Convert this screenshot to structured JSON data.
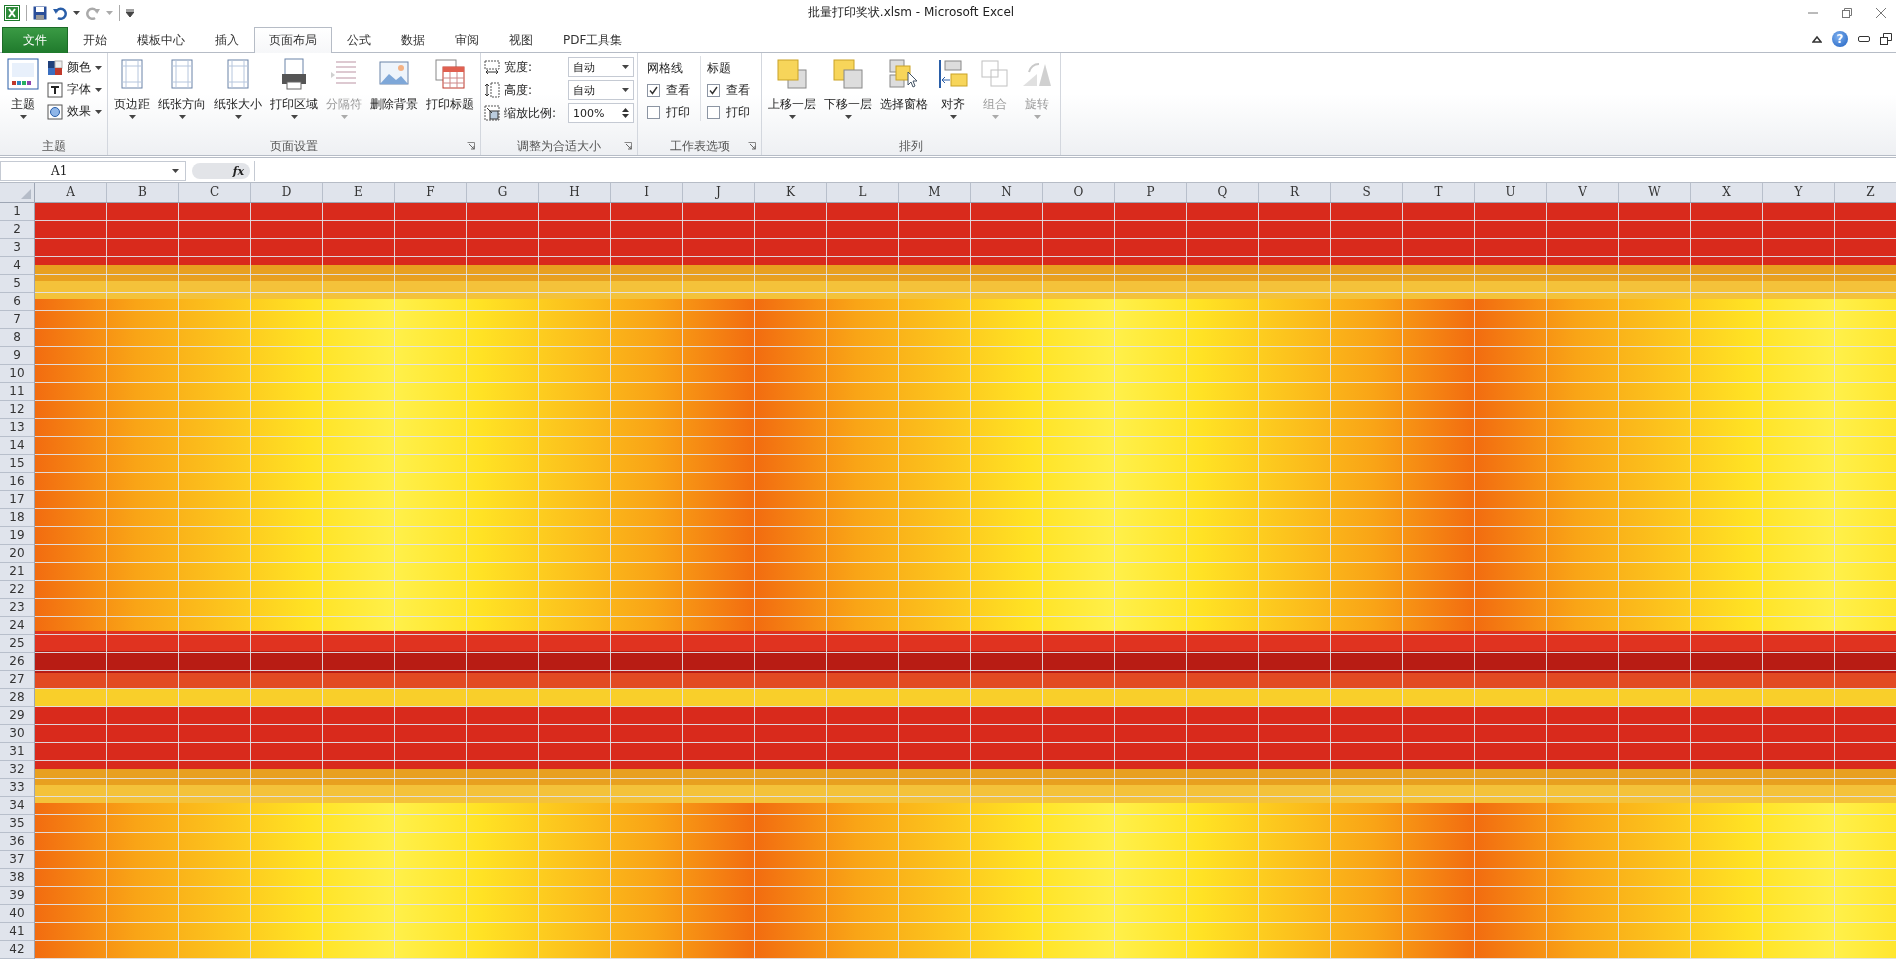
{
  "window": {
    "title": "批量打印奖状.xlsm  -  Microsoft Excel"
  },
  "tabs": [
    {
      "label": "文件",
      "kind": "file",
      "selected": false
    },
    {
      "label": "开始",
      "kind": "tab",
      "selected": false
    },
    {
      "label": "模板中心",
      "kind": "tab",
      "selected": false
    },
    {
      "label": "插入",
      "kind": "tab",
      "selected": false
    },
    {
      "label": "页面布局",
      "kind": "tab",
      "selected": true
    },
    {
      "label": "公式",
      "kind": "tab",
      "selected": false
    },
    {
      "label": "数据",
      "kind": "tab",
      "selected": false
    },
    {
      "label": "审阅",
      "kind": "tab",
      "selected": false
    },
    {
      "label": "视图",
      "kind": "tab",
      "selected": false
    },
    {
      "label": "PDF工具集",
      "kind": "tab",
      "selected": false
    }
  ],
  "help_button": {
    "label": "?"
  },
  "ribbon": {
    "groups": [
      {
        "title": "主题",
        "launcher": false,
        "items": [
          {
            "kind": "large",
            "label": "主题",
            "dropdown": true,
            "disabled": false
          },
          {
            "kind": "stack",
            "items": [
              {
                "label": "颜色",
                "dropdown": true
              },
              {
                "label": "字体",
                "dropdown": true
              },
              {
                "label": "效果",
                "dropdown": true
              }
            ]
          }
        ]
      },
      {
        "title": "页面设置",
        "launcher": true,
        "items": [
          {
            "kind": "large",
            "label": "页边距",
            "dropdown": true,
            "disabled": false
          },
          {
            "kind": "large",
            "label": "纸张方向",
            "dropdown": true,
            "disabled": false
          },
          {
            "kind": "large",
            "label": "纸张大小",
            "dropdown": true,
            "disabled": false
          },
          {
            "kind": "large",
            "label": "打印区域",
            "dropdown": true,
            "disabled": false
          },
          {
            "kind": "large",
            "label": "分隔符",
            "dropdown": true,
            "disabled": true
          },
          {
            "kind": "large",
            "label": "删除背景",
            "dropdown": false,
            "disabled": false
          },
          {
            "kind": "large",
            "label": "打印标题",
            "dropdown": false,
            "disabled": false
          }
        ]
      },
      {
        "title": "调整为合适大小",
        "launcher": true,
        "items": [
          {
            "kind": "fields",
            "items": [
              {
                "kind": "dropdown",
                "label": "宽度:",
                "value": "自动"
              },
              {
                "kind": "dropdown",
                "label": "高度:",
                "value": "自动"
              },
              {
                "kind": "spinner",
                "label": "缩放比例:",
                "value": "100%"
              }
            ]
          }
        ]
      },
      {
        "title": "工作表选项",
        "launcher": true,
        "items": [
          {
            "kind": "checks",
            "title": "网格线",
            "items": [
              {
                "label": "查看",
                "checked": true
              },
              {
                "label": "打印",
                "checked": false
              }
            ]
          },
          {
            "kind": "checks",
            "title": "标题",
            "items": [
              {
                "label": "查看",
                "checked": true
              },
              {
                "label": "打印",
                "checked": false
              }
            ]
          }
        ]
      },
      {
        "title": "排列",
        "launcher": false,
        "items": [
          {
            "kind": "large",
            "label": "上移一层",
            "dropdown": true,
            "disabled": false
          },
          {
            "kind": "large",
            "label": "下移一层",
            "dropdown": true,
            "disabled": false
          },
          {
            "kind": "large",
            "label": "选择窗格",
            "dropdown": false,
            "disabled": false
          },
          {
            "kind": "large",
            "label": "对齐",
            "dropdown": true,
            "disabled": false
          },
          {
            "kind": "large",
            "label": "组合",
            "dropdown": true,
            "disabled": true
          },
          {
            "kind": "large",
            "label": "旋转",
            "dropdown": true,
            "disabled": true
          }
        ]
      }
    ]
  },
  "name_box": {
    "value": "A1"
  },
  "formula_bar": {
    "function_label": "fx"
  },
  "sheet": {
    "columns": [
      "A",
      "B",
      "C",
      "D",
      "E",
      "F",
      "G",
      "H",
      "I",
      "J",
      "K",
      "L",
      "M",
      "N",
      "O",
      "P",
      "Q",
      "R",
      "S",
      "T",
      "U",
      "V",
      "W",
      "X",
      "Y",
      "Z"
    ],
    "rows": [
      "1",
      "2",
      "3",
      "4",
      "5",
      "6",
      "7",
      "8",
      "9",
      "10",
      "11",
      "12",
      "13",
      "14",
      "15",
      "16",
      "17",
      "18",
      "19",
      "20",
      "21",
      "22",
      "23",
      "24",
      "25",
      "26",
      "27",
      "28",
      "29",
      "30",
      "31",
      "32",
      "33",
      "34",
      "35",
      "36",
      "37",
      "38",
      "39",
      "40",
      "41",
      "42"
    ]
  }
}
